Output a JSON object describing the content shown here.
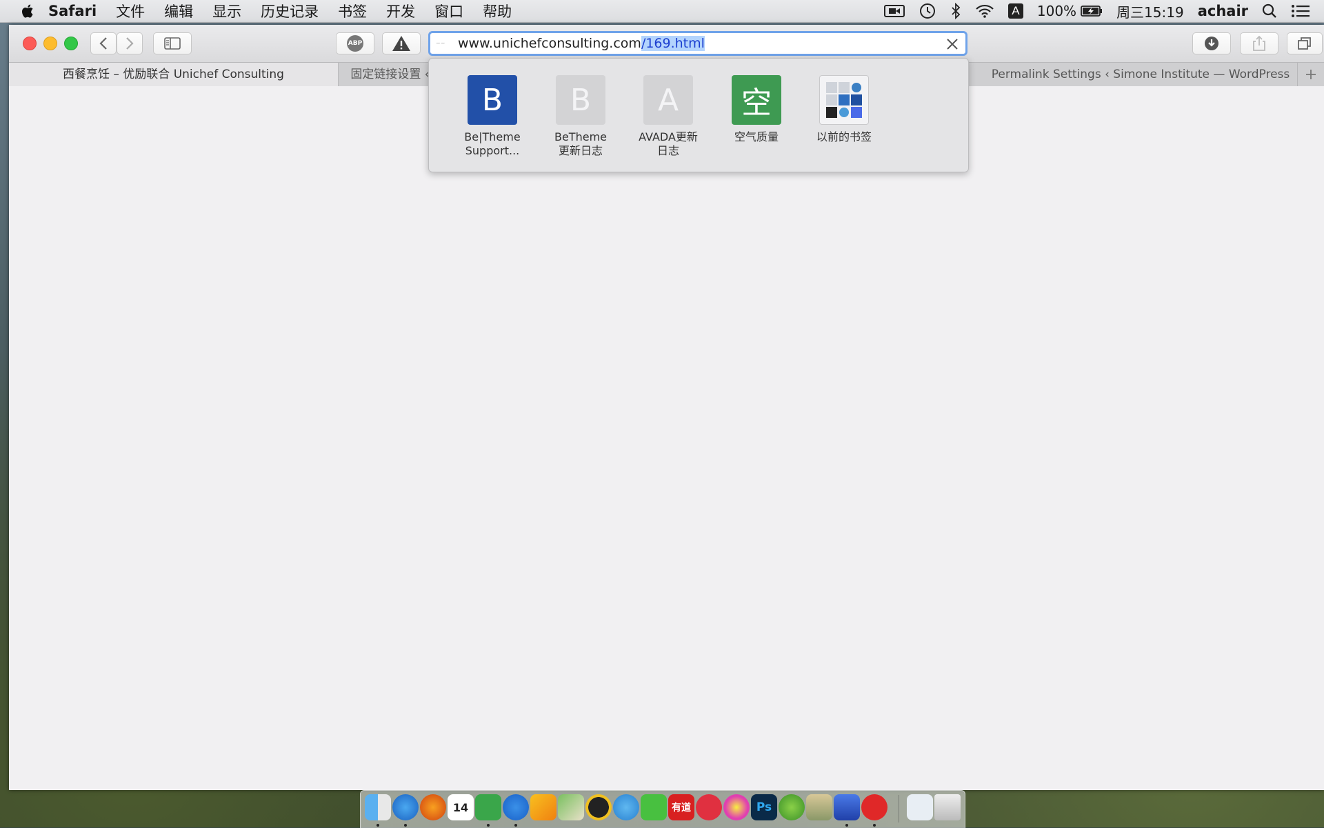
{
  "menubar": {
    "app_name": "Safari",
    "items": [
      "文件",
      "编辑",
      "显示",
      "历史记录",
      "书签",
      "开发",
      "窗口",
      "帮助"
    ],
    "input_method": "A",
    "battery": "100%",
    "clock": "周三15:19",
    "user": "achair"
  },
  "toolbar": {
    "url_plain": "www.unichefconsulting.com",
    "url_selected": "/169.html",
    "abp_label": "ABP"
  },
  "tabs": [
    {
      "title": "西餐烹饪 – 优励联合 Unichef Consulting"
    },
    {
      "title": "固定链接设置 ‹"
    },
    {
      "title": "Permalink Settings ‹ Simone Institute — WordPress"
    }
  ],
  "favorites": [
    {
      "tile_text": "B",
      "label_line1": "Be|Theme",
      "label_line2": "Support...",
      "color": "#2250a8"
    },
    {
      "tile_text": "B",
      "label_line1": "BeTheme",
      "label_line2": "更新日志",
      "color": "#d3d3d5"
    },
    {
      "tile_text": "A",
      "label_line1": "AVADA更新",
      "label_line2": "日志",
      "color": "#d3d3d5"
    },
    {
      "tile_text": "空",
      "label_line1": "空气质量",
      "label_line2": "",
      "color": "#3e9a52"
    },
    {
      "tile_text": "",
      "label_line1": "以前的书签",
      "label_line2": "",
      "color": "#f3f3f5"
    }
  ],
  "dock": {
    "calendar_day": "14",
    "youdao_label": "有道",
    "ps_label": "Ps",
    "icons": [
      "finder-icon",
      "safari-icon",
      "firefox-icon",
      "calendar-icon",
      "evernote-icon",
      "sogou-icon",
      "tes-butterfly-icon",
      "maps-icon",
      "qq-icon",
      "qq-mail-icon",
      "wechat-icon",
      "youdao-icon",
      "g-app-icon",
      "flower-icon",
      "photoshop-icon",
      "leaf-icon",
      "transmit-icon",
      "imovie-icon",
      "netease-music-icon",
      "documents-icon",
      "trash-icon"
    ]
  },
  "colors": {
    "accent": "#6fa3ea",
    "selection": "#b3d4fd"
  }
}
